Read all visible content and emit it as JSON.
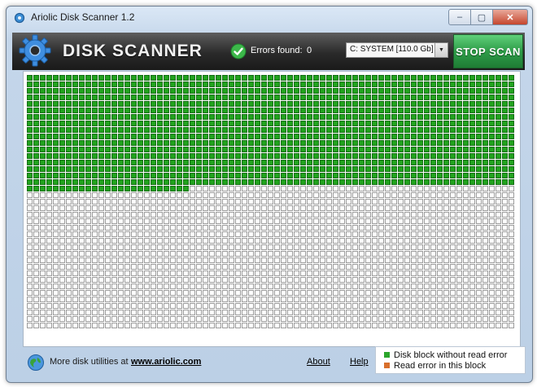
{
  "window": {
    "title": "Ariolic Disk Scanner 1.2",
    "controls": {
      "minimize": "–",
      "maximize": "▢",
      "close": "✕"
    }
  },
  "header": {
    "brand": "DISK SCANNER",
    "errors_label": "Errors found:",
    "errors_count": "0",
    "drive_selected": "C: SYSTEM [110.0 Gb]",
    "stop_button": "STOP SCAN",
    "icons": {
      "logo": "gear-icon",
      "status": "green-check-icon"
    }
  },
  "scan_grid": {
    "columns": 75,
    "rows": 39,
    "scanned_full_rows": 17,
    "scanned_partial_cells": 25,
    "scanned_color": "#22a31e",
    "empty_color": "#ffffff",
    "cell_border": "#9c9c9c"
  },
  "footer": {
    "more_text": "More disk utilities at",
    "more_link": "www.ariolic.com",
    "about": "About",
    "help": "Help",
    "legend": [
      {
        "label": "Disk block without read error",
        "color": "#2ba52b"
      },
      {
        "label": "Read error in this block",
        "color": "#d86f2c"
      }
    ]
  }
}
